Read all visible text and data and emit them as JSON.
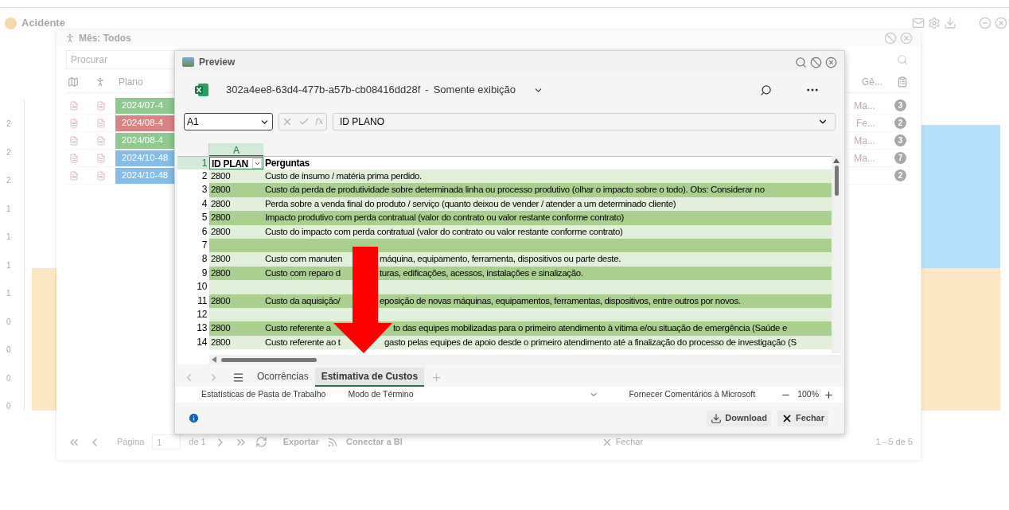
{
  "dashboard": {
    "title": "Acidente",
    "chart_labels": [
      "2",
      "2",
      "2",
      "1",
      "1",
      "1",
      "1",
      "0",
      "0",
      "0",
      "0"
    ]
  },
  "month_window": {
    "title": "Mês: Todos",
    "search": {
      "placeholder": "Procurar"
    },
    "columns": [
      "Plano",
      "Gê..."
    ],
    "rows": [
      {
        "plan": "2024/07-4",
        "color": "#8fc98f",
        "gender": "Ma...",
        "count": "3"
      },
      {
        "plan": "2024/08-4",
        "color": "#d98484",
        "gender": "Fe...",
        "count": "2"
      },
      {
        "plan": "2024/08-4",
        "color": "#8fc98f",
        "gender": "Ma...",
        "count": "3"
      },
      {
        "plan": "2024/10-48",
        "color": "#86bde6",
        "gender": "Ma...",
        "count": "7"
      },
      {
        "plan": "2024/10-48",
        "color": "#86bde6",
        "count": "2"
      }
    ],
    "pager": {
      "page_label": "Página",
      "page": "1",
      "of": "de 1",
      "export": "Exportar",
      "bi": "Conectar a BI",
      "close": "Fechar",
      "range": "1 - 5 de 5"
    }
  },
  "preview": {
    "title": "Preview",
    "file": "302a4ee8-63d4-477b-a57b-cb08416dd28f",
    "separator": "-",
    "mode": "Somente exibição",
    "name_box": "A1",
    "function_label": "fx",
    "formula": "ID PLANO",
    "column": "A",
    "header": {
      "n": "1",
      "a": "ID PLAN",
      "b": "Perguntas"
    },
    "rows": [
      {
        "n": "2",
        "a": "2800",
        "b": [
          "Custo de insumo / matéria prima perdido."
        ]
      },
      {
        "n": "3",
        "a": "2800",
        "b": [
          "Custo da perda de produtividade sobre determinada linha ou processo produtivo (olhar o impacto sobre o todo). Obs: Considerar no"
        ]
      },
      {
        "n": "4",
        "a": "2800",
        "b": [
          "Perda sobre a venda final do produto / serviço (quanto deixou de vender / atender a um determinado cliente)"
        ]
      },
      {
        "n": "5",
        "a": "2800",
        "b": [
          "Impacto produtivo com perda contratual (valor do contrato ou valor restante conforme contrato)"
        ]
      },
      {
        "n": "6",
        "a": "2800",
        "b": [
          "Custo do impacto com perda contratual (valor do contrato ou valor restante conforme contrato)"
        ]
      },
      {
        "n": "7"
      },
      {
        "n": "8",
        "a": "2800",
        "b": [
          "Custo com manuten",
          "máquina, equipamento, ferramenta, dispositivos ou parte deste."
        ]
      },
      {
        "n": "9",
        "a": "2800",
        "b": [
          "Custo com reparo d",
          "turas, edificações, acessos, instalações e sinalização."
        ]
      },
      {
        "n": "10"
      },
      {
        "n": "11",
        "a": "2800",
        "b": [
          "Custo da aquisição/",
          "eposição de novas máquinas, equipamentos, ferramentas, dispositivos, entre outros por novos."
        ]
      },
      {
        "n": "12"
      },
      {
        "n": "13",
        "a": "2800",
        "b": [
          "Custo referente a",
          "to das equipes mobilizadas para o primeiro atendimento à vítima e/ou situação de emergência (Saúde e"
        ]
      },
      {
        "n": "14",
        "a": "2800",
        "b": [
          "Custo referente ao t",
          "gasto pelas equipes de apoio desde o primeiro atendimento até a finalização do processo de investigação (S"
        ]
      }
    ],
    "sheets": [
      {
        "label": "Ocorrências",
        "selected": false
      },
      {
        "label": "Estimativa de Custos",
        "selected": true
      }
    ],
    "status": {
      "stats": "Estatísticas de Pasta de Trabalho",
      "mode": "Modo de Término",
      "feedback": "Fornecer Comentários à Microsoft",
      "zoom": "100%"
    },
    "buttons": {
      "download": "Download",
      "close": "Fechar"
    }
  }
}
